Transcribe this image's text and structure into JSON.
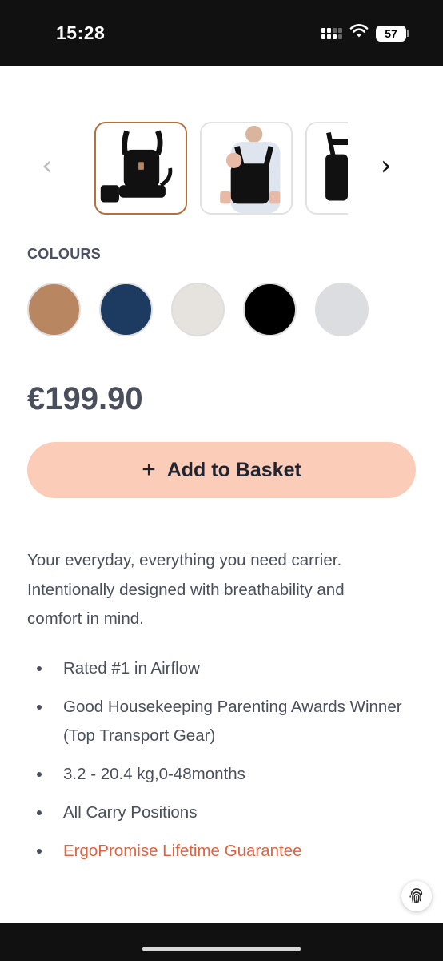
{
  "status_bar": {
    "time": "15:28",
    "battery": "57",
    "icons": [
      "signal-icon",
      "wifi-icon",
      "battery-icon"
    ]
  },
  "gallery": {
    "prev_icon": "chevron-left-icon",
    "next_icon": "chevron-right-icon",
    "prev_glyph": "‹",
    "next_glyph": "›",
    "selected_index": 0,
    "thumbnails": [
      "carrier-front-black",
      "carrier-worn-by-parent",
      "carrier-side-view"
    ]
  },
  "colours": {
    "label": "COLOURS",
    "swatches": [
      "#b88762",
      "#1d3a60",
      "#e6e3df",
      "#000000",
      "#dcdde0"
    ]
  },
  "product": {
    "price": "€199.90",
    "add_button_icon": "+",
    "add_button_label": "Add to Basket",
    "description": "Your everyday, everything you need carrier. Intentionally designed with breathability and comfort in mind.",
    "features": [
      "Rated #1 in Airflow",
      "Good Housekeeping Parenting Awards Winner (Top Transport Gear)",
      "3.2 - 20.4 kg,0-48months",
      "All Carry Positions",
      "ErgoPromise Lifetime Guarantee"
    ]
  },
  "colors": {
    "accent_button": "#fbcdb8",
    "link": "#e0643f",
    "selected_border": "#b46f3c"
  },
  "floating_icon": "fingerprint-icon"
}
